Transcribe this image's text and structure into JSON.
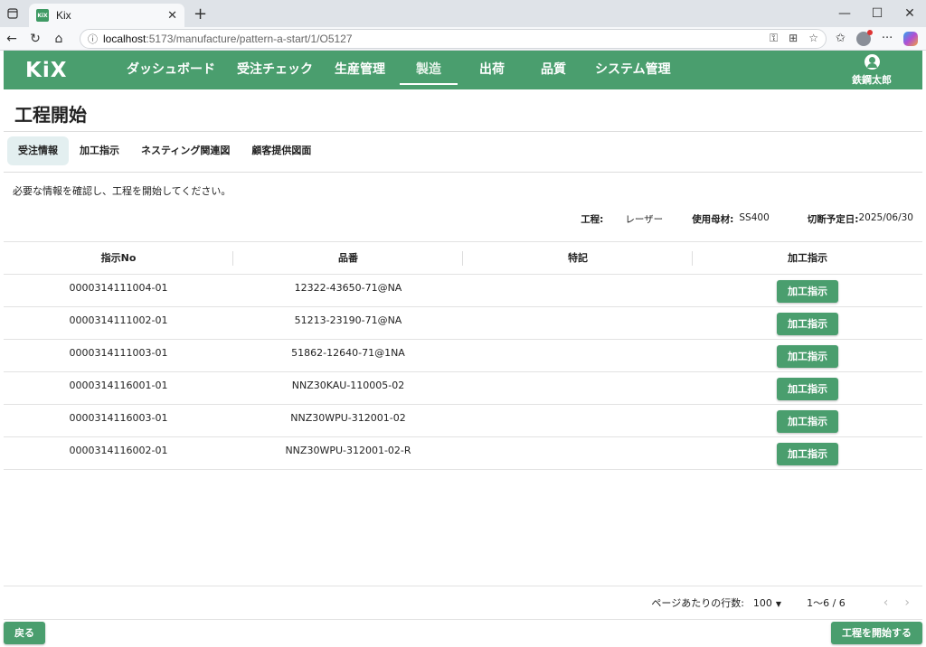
{
  "browser": {
    "tab_title": "Kix",
    "favicon_text": "KiX",
    "url_host": "localhost",
    "url_path": ":5173/manufacture/pattern-a-start/1/O5127"
  },
  "header": {
    "logo": "KiX",
    "nav": [
      "ダッシュボード",
      "受注チェック",
      "生産管理",
      "製造",
      "出荷",
      "品質",
      "システム管理"
    ],
    "active_nav": "製造",
    "user_name": "鉄鋼太郎"
  },
  "page": {
    "title": "工程開始",
    "tabs": [
      "受注情報",
      "加工指示",
      "ネスティング関連図",
      "顧客提供図面"
    ],
    "active_tab": "受注情報",
    "notice": "必要な情報を確認し、工程を開始してください。"
  },
  "meta": {
    "process_label": "工程:",
    "process_value": "レーザー",
    "material_label": "使用母材:",
    "material_value": "SS400",
    "cut_date_label": "切断予定日:",
    "cut_date_value": "2025/06/30"
  },
  "table": {
    "columns": [
      "指示No",
      "品番",
      "特記",
      "加工指示"
    ],
    "rows": [
      {
        "no": "0000314111004-01",
        "part": "12322-43650-71@NA",
        "note": "",
        "action": "加工指示"
      },
      {
        "no": "0000314111002-01",
        "part": "51213-23190-71@NA",
        "note": "",
        "action": "加工指示"
      },
      {
        "no": "0000314111003-01",
        "part": "51862-12640-71@1NA",
        "note": "",
        "action": "加工指示"
      },
      {
        "no": "0000314116001-01",
        "part": "NNZ30KAU-110005-02",
        "note": "",
        "action": "加工指示"
      },
      {
        "no": "0000314116003-01",
        "part": "NNZ30WPU-312001-02",
        "note": "",
        "action": "加工指示"
      },
      {
        "no": "0000314116002-01",
        "part": "NNZ30WPU-312001-02-R",
        "note": "",
        "action": "加工指示"
      }
    ]
  },
  "pager": {
    "rows_label": "ページあたりの行数:",
    "rows_value": "100",
    "range": "1〜6 / 6"
  },
  "footer": {
    "back_label": "戻る",
    "start_label": "工程を開始する"
  },
  "colors": {
    "brand": "#4a9e6e",
    "active_tab_bg": "#e3eff0"
  }
}
